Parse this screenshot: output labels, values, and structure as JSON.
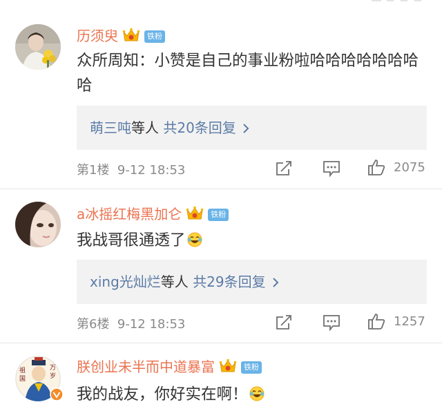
{
  "comments": [
    {
      "username": "历须臾",
      "badge": "铁粉",
      "text": "众所周知：小赞是自己的事业粉啦哈哈哈哈哈哈哈哈",
      "reply": {
        "names": "萌三吨",
        "suffix": "等人",
        "count_text": "共20条回复"
      },
      "floor": "第1楼",
      "time": "9-12 18:53",
      "likes": "2075"
    },
    {
      "username": "a冰摇红梅黑加仑",
      "badge": "铁粉",
      "text": "我战哥很通透了",
      "reply": {
        "names": "xing光灿烂",
        "suffix": "等人",
        "count_text": "共29条回复"
      },
      "floor": "第6楼",
      "time": "9-12 18:53",
      "likes": "1257"
    },
    {
      "username": "朕创业未半而中道暴富",
      "badge": "铁粉",
      "text": "我的战友，你好实在啊！",
      "avatar_text": [
        "祖",
        "国",
        "万",
        "岁"
      ]
    }
  ],
  "colors": {
    "username": "#eb7350",
    "link_blue": "#5b7ba6",
    "badge_blue": "#69b3e7",
    "meta_gray": "#8a8a8a",
    "reply_bg": "#f2f2f2",
    "crown_gold": "#f6b900",
    "crown_red": "#e0452e"
  },
  "icons": [
    "crown-vip-icon",
    "laugh-cry-emoji-icon",
    "chevron-right-icon",
    "repost-icon",
    "comment-icon",
    "like-icon"
  ]
}
